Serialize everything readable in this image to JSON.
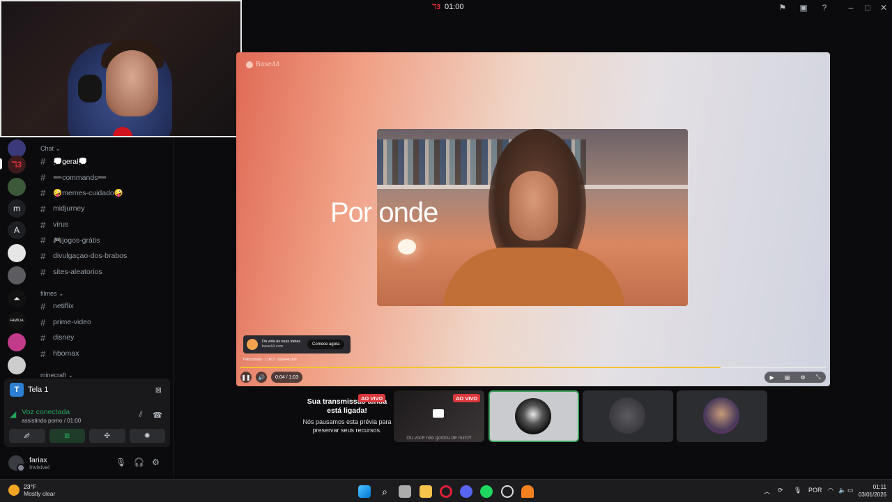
{
  "topbar": {
    "stream_timer": "01:00",
    "rec_glyph": "ℸ3",
    "icons": [
      "flag-icon",
      "inbox-icon",
      "help-icon",
      "minimize-icon",
      "maximize-icon",
      "close-icon"
    ]
  },
  "servers": {
    "items": [
      {
        "label": "",
        "icon": "server-avatar"
      },
      {
        "label": "",
        "icon": "server-avatar-active"
      },
      {
        "label": "",
        "icon": "server-avatar"
      },
      {
        "label": "m",
        "icon": "server-letter"
      },
      {
        "label": "A",
        "icon": "server-letter"
      },
      {
        "label": "",
        "icon": "server-avatar"
      },
      {
        "label": "",
        "icon": "server-avatar"
      },
      {
        "label": "",
        "icon": "server-avatar"
      },
      {
        "label": "",
        "icon": "server-avatar"
      },
      {
        "label": "",
        "icon": "server-avatar"
      },
      {
        "label": "",
        "icon": "server-avatar"
      }
    ]
  },
  "channels": {
    "categories": [
      "Chat",
      "filmes",
      "minecraft"
    ],
    "chat": [
      "💭geral💭",
      "➖commands➖",
      "🤪memes-cuidado🤪",
      "midjurney",
      "virus",
      "🎮jogos-grátis",
      "divulgaçao-dos-brabos",
      "sites-aleatorios"
    ],
    "filmes": [
      "netiflix",
      "prime-video",
      "disney",
      "hbomax"
    ]
  },
  "voice": {
    "screen_name": "Tela 1",
    "screen_avatar": "T",
    "status": "Voz conectada",
    "sub_status": "assistindo porno / 01:00"
  },
  "user": {
    "name": "fariax",
    "status": "Invisível"
  },
  "stream": {
    "brand": "Base44",
    "headline": "Por onde",
    "ad_title": "Dá vida às suas ideias",
    "ad_domain": "base44.com",
    "ad_button": "Comece agora",
    "ad_meta": "Patrocinado · 1 de 2 · base44.com",
    "time": "0:04 / 1:03",
    "progress": 0.82
  },
  "notice": {
    "title": "Sua transmissão ainda está ligada!",
    "body": "Nós pausamos esta prévia para preservar seus recursos."
  },
  "tiles": {
    "live_label": "AO VIVO",
    "caption": "Ou você não gostou de mim?!"
  },
  "taskbar": {
    "temp": "23°F",
    "weather": "Mostly clear",
    "lang": "POR",
    "time": "01:11",
    "date": "03/01/2026"
  },
  "colors": {
    "accent_green": "#23a55a",
    "live_red": "#da373c",
    "progress_yellow": "#f4c430"
  }
}
